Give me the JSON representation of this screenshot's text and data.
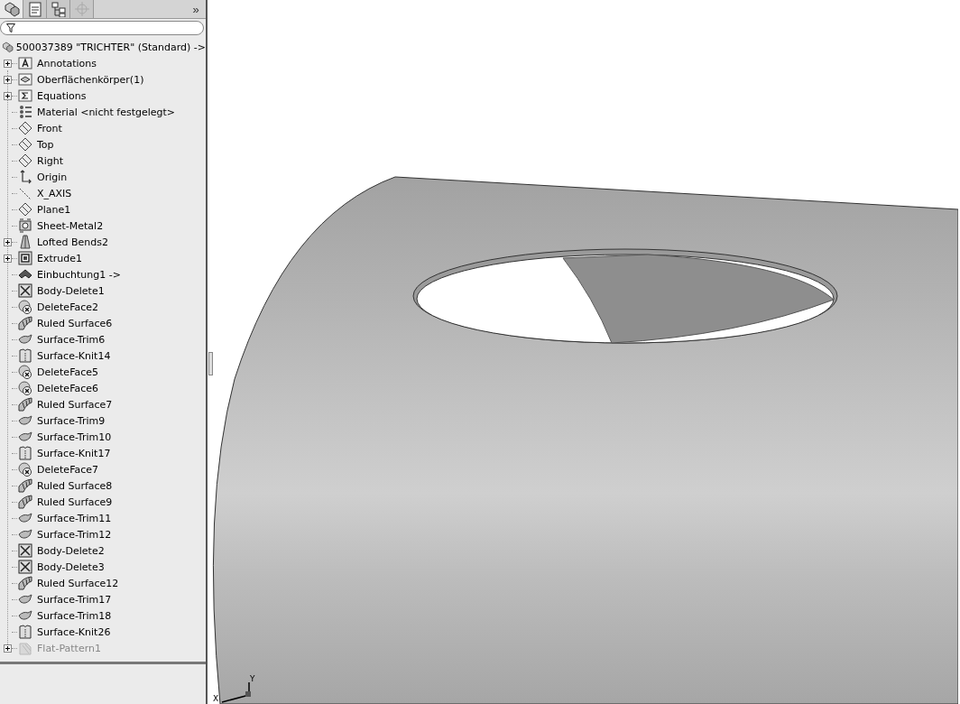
{
  "panel_tabs": [
    {
      "kind": "feature-manager",
      "selected": true
    },
    {
      "kind": "property-manager",
      "selected": false
    },
    {
      "kind": "configuration-manager",
      "selected": false
    },
    {
      "kind": "dim-xpert",
      "selected": false
    }
  ],
  "overflow": "»",
  "tree": {
    "root": {
      "label": "500037389 \"TRICHTER\"  (Standard) ->"
    },
    "items": [
      {
        "label": "Annotations",
        "kind": "annotations",
        "expander": true,
        "suppressed": false
      },
      {
        "label": "Oberflächenkörper(1)",
        "kind": "surface-bodies",
        "expander": true,
        "suppressed": false
      },
      {
        "label": "Equations",
        "kind": "equations",
        "expander": true,
        "suppressed": false
      },
      {
        "label": "Material <nicht festgelegt>",
        "kind": "material",
        "expander": false,
        "suppressed": false
      },
      {
        "label": "Front",
        "kind": "plane",
        "expander": false,
        "suppressed": false
      },
      {
        "label": "Top",
        "kind": "plane",
        "expander": false,
        "suppressed": false
      },
      {
        "label": "Right",
        "kind": "plane",
        "expander": false,
        "suppressed": false
      },
      {
        "label": "Origin",
        "kind": "origin",
        "expander": false,
        "suppressed": false
      },
      {
        "label": "X_AXIS",
        "kind": "axis",
        "expander": false,
        "suppressed": false
      },
      {
        "label": "Plane1",
        "kind": "plane",
        "expander": false,
        "suppressed": false
      },
      {
        "label": "Sheet-Metal2",
        "kind": "sheet-metal",
        "expander": false,
        "suppressed": false
      },
      {
        "label": "Lofted Bends2",
        "kind": "lofted-bends",
        "expander": true,
        "suppressed": false
      },
      {
        "label": "Extrude1",
        "kind": "extrude",
        "expander": true,
        "suppressed": false
      },
      {
        "label": "Einbuchtung1 ->",
        "kind": "indent",
        "expander": false,
        "suppressed": false
      },
      {
        "label": "Body-Delete1",
        "kind": "body-delete",
        "expander": false,
        "suppressed": false
      },
      {
        "label": "DeleteFace2",
        "kind": "delete-face",
        "expander": false,
        "suppressed": false
      },
      {
        "label": "Ruled Surface6",
        "kind": "ruled-surface",
        "expander": false,
        "suppressed": false
      },
      {
        "label": "Surface-Trim6",
        "kind": "surface-trim",
        "expander": false,
        "suppressed": false
      },
      {
        "label": "Surface-Knit14",
        "kind": "surface-knit",
        "expander": false,
        "suppressed": false
      },
      {
        "label": "DeleteFace5",
        "kind": "delete-face",
        "expander": false,
        "suppressed": false
      },
      {
        "label": "DeleteFace6",
        "kind": "delete-face",
        "expander": false,
        "suppressed": false
      },
      {
        "label": "Ruled Surface7",
        "kind": "ruled-surface",
        "expander": false,
        "suppressed": false
      },
      {
        "label": "Surface-Trim9",
        "kind": "surface-trim",
        "expander": false,
        "suppressed": false
      },
      {
        "label": "Surface-Trim10",
        "kind": "surface-trim",
        "expander": false,
        "suppressed": false
      },
      {
        "label": "Surface-Knit17",
        "kind": "surface-knit",
        "expander": false,
        "suppressed": false
      },
      {
        "label": "DeleteFace7",
        "kind": "delete-face",
        "expander": false,
        "suppressed": false
      },
      {
        "label": "Ruled Surface8",
        "kind": "ruled-surface",
        "expander": false,
        "suppressed": false
      },
      {
        "label": "Ruled Surface9",
        "kind": "ruled-surface",
        "expander": false,
        "suppressed": false
      },
      {
        "label": "Surface-Trim11",
        "kind": "surface-trim",
        "expander": false,
        "suppressed": false
      },
      {
        "label": "Surface-Trim12",
        "kind": "surface-trim",
        "expander": false,
        "suppressed": false
      },
      {
        "label": "Body-Delete2",
        "kind": "body-delete",
        "expander": false,
        "suppressed": false
      },
      {
        "label": "Body-Delete3",
        "kind": "body-delete",
        "expander": false,
        "suppressed": false
      },
      {
        "label": "Ruled Surface12",
        "kind": "ruled-surface",
        "expander": false,
        "suppressed": false
      },
      {
        "label": "Surface-Trim17",
        "kind": "surface-trim",
        "expander": false,
        "suppressed": false
      },
      {
        "label": "Surface-Trim18",
        "kind": "surface-trim",
        "expander": false,
        "suppressed": false
      },
      {
        "label": "Surface-Knit26",
        "kind": "surface-knit",
        "expander": false,
        "suppressed": false
      },
      {
        "label": "Flat-Pattern1",
        "kind": "flat-pattern",
        "expander": true,
        "suppressed": true
      }
    ]
  },
  "triad": {
    "x_label": "X",
    "y_label": "Y"
  }
}
